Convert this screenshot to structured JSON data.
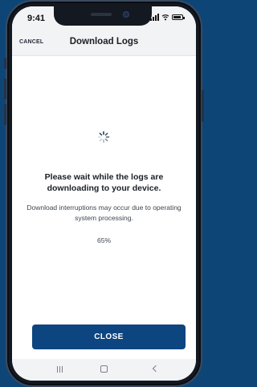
{
  "status_bar": {
    "time": "9:41"
  },
  "header": {
    "cancel_label": "CANCEL",
    "title": "Download Logs"
  },
  "main": {
    "wait_message": "Please wait while the logs are downloading to your device.",
    "info_message": "Download interruptions may occur due to operating system processing.",
    "progress_text": "65%",
    "progress": 0.65
  },
  "footer": {
    "close_label": "CLOSE"
  },
  "colors": {
    "background": "#0e4577",
    "primary_button": "#0d4580",
    "header_bg": "#f2f3f5"
  },
  "icons": {
    "spinner": "spinner-icon",
    "nav": [
      "recents-icon",
      "home-icon",
      "back-icon"
    ]
  }
}
